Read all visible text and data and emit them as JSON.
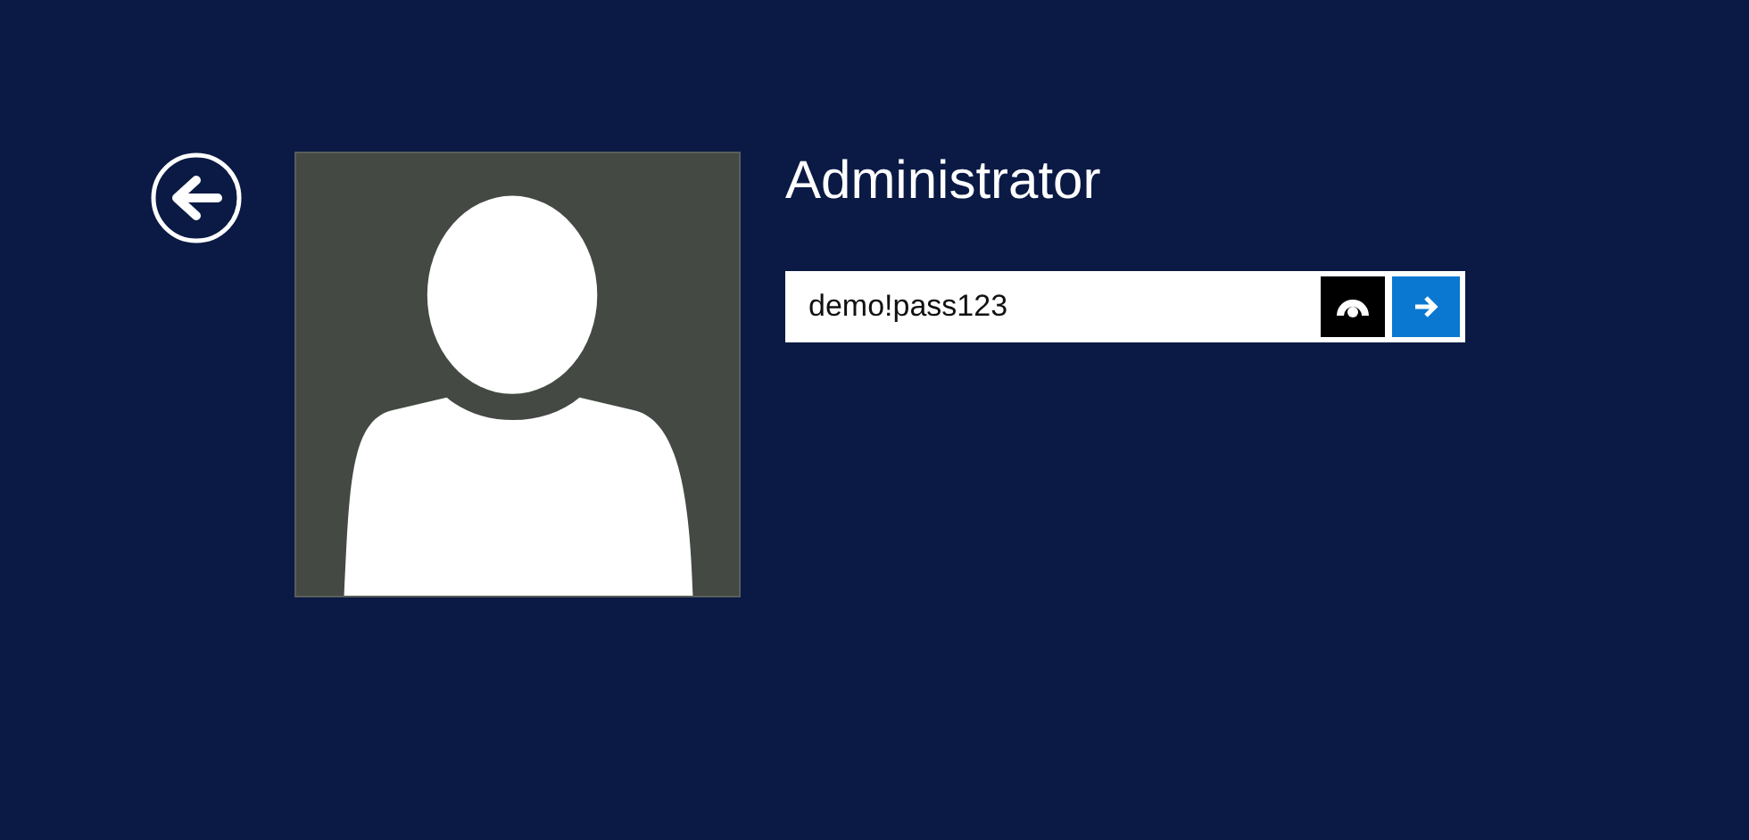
{
  "user": {
    "name": "Administrator"
  },
  "password": {
    "value": "demo!pass123"
  }
}
